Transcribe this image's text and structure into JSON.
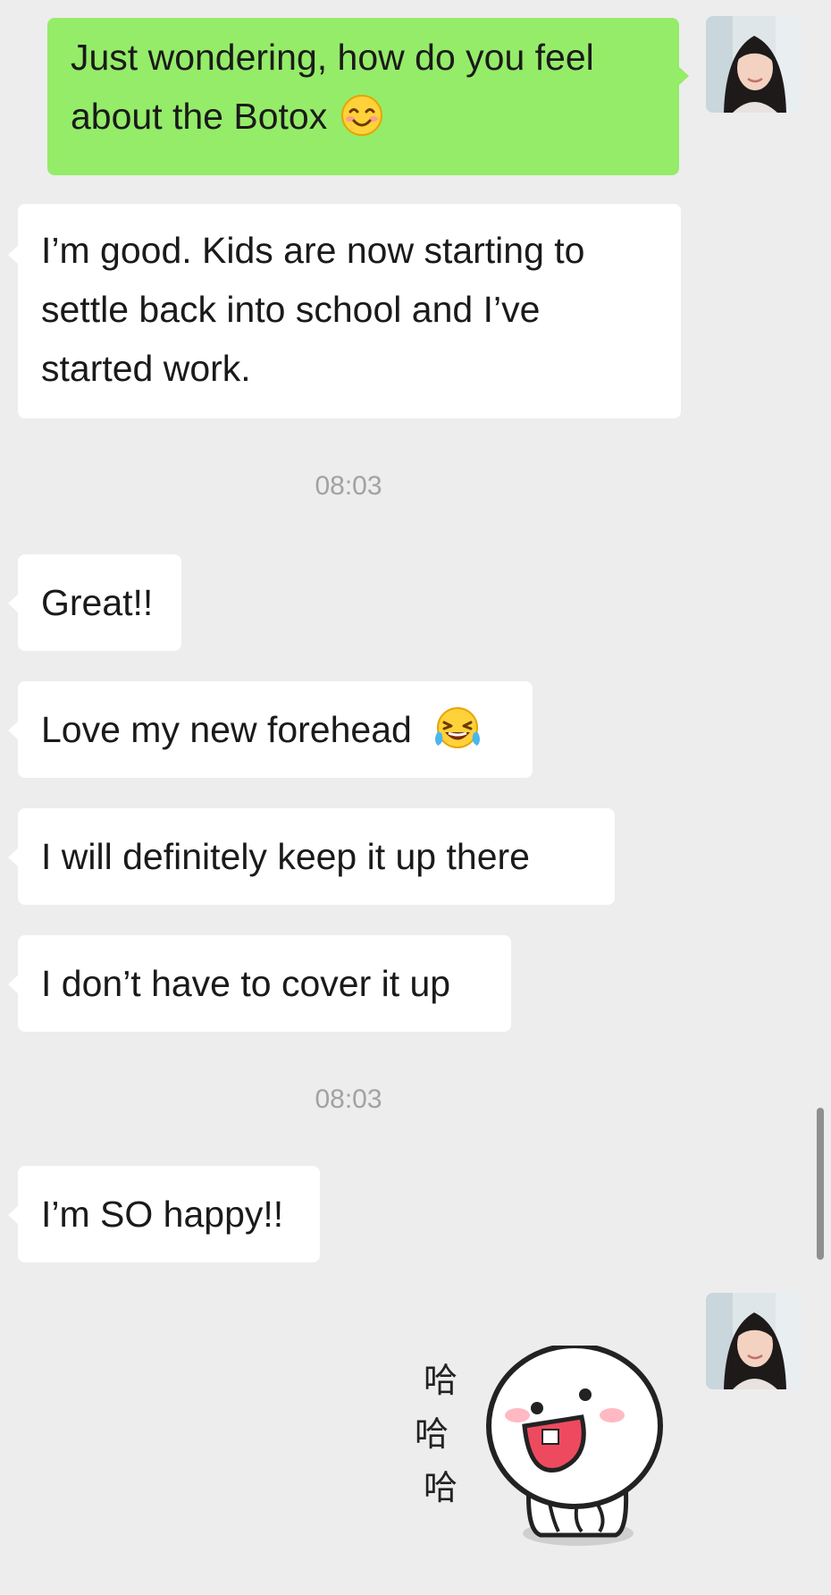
{
  "messages": [
    {
      "from": "me",
      "lines": [
        "Just wondering, how do you feel",
        "about the Botox"
      ],
      "emoji": "smiling-blushing-emoji"
    },
    {
      "from": "other",
      "lines": [
        "I’m good.  Kids are now starting to",
        "settle back into school and I’ve",
        "started work."
      ]
    },
    {
      "timestamp": "08:03"
    },
    {
      "from": "other",
      "text": "Great!!"
    },
    {
      "from": "other",
      "text": "Love my new forehead",
      "emoji": "tears-of-joy-emoji"
    },
    {
      "from": "other",
      "text": "I will definitely keep it up there"
    },
    {
      "from": "other",
      "text": "I don’t have to cover it up"
    },
    {
      "timestamp": "08:03"
    },
    {
      "from": "other",
      "text": "I’m SO happy!!"
    },
    {
      "from": "me",
      "sticker": "laughing-round-head-sticker",
      "sticker_text": [
        "哈",
        "哈",
        "哈"
      ]
    }
  ],
  "colors": {
    "background": "#ededed",
    "outgoing_bubble": "#95ec69",
    "incoming_bubble": "#ffffff",
    "timestamp_text": "#a2a2a2"
  },
  "icons": [
    "user-avatar",
    "smiling-blushing-emoji",
    "tears-of-joy-emoji",
    "laughing-round-head-sticker",
    "scrollbar"
  ]
}
